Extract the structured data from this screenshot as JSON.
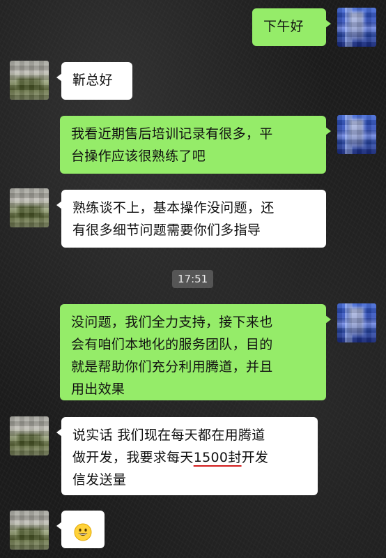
{
  "messages": [
    {
      "from": "self",
      "text": "下午好"
    },
    {
      "from": "other",
      "text": "靳总好"
    },
    {
      "from": "self",
      "lines": [
        "我看近期售后培训记录有很多，平",
        "台操作应该很熟练了吧"
      ]
    },
    {
      "from": "other",
      "lines": [
        "熟练谈不上，基本操作没问题，还",
        "有很多细节问题需要你们多指导"
      ]
    },
    {
      "timestamp": "17:51"
    },
    {
      "from": "self",
      "lines": [
        "没问题，我们全力支持，接下来也",
        "会有咱们本地化的服务团队，目的",
        "就是帮助你们充分利用腾道，并且",
        "用出效果"
      ]
    },
    {
      "from": "other",
      "line1": "说实话 我们现在每天都在用腾道",
      "line2_prefix": "做开发，我要求每天",
      "line2_highlight": "1500封",
      "line2_suffix": "开发",
      "line3": "信发送量"
    },
    {
      "from": "other",
      "emoji": "grinning-face-icon"
    }
  ],
  "colors": {
    "self_bubble": "#95ec69",
    "other_bubble": "#ffffff",
    "underline": "#d21a1a"
  }
}
